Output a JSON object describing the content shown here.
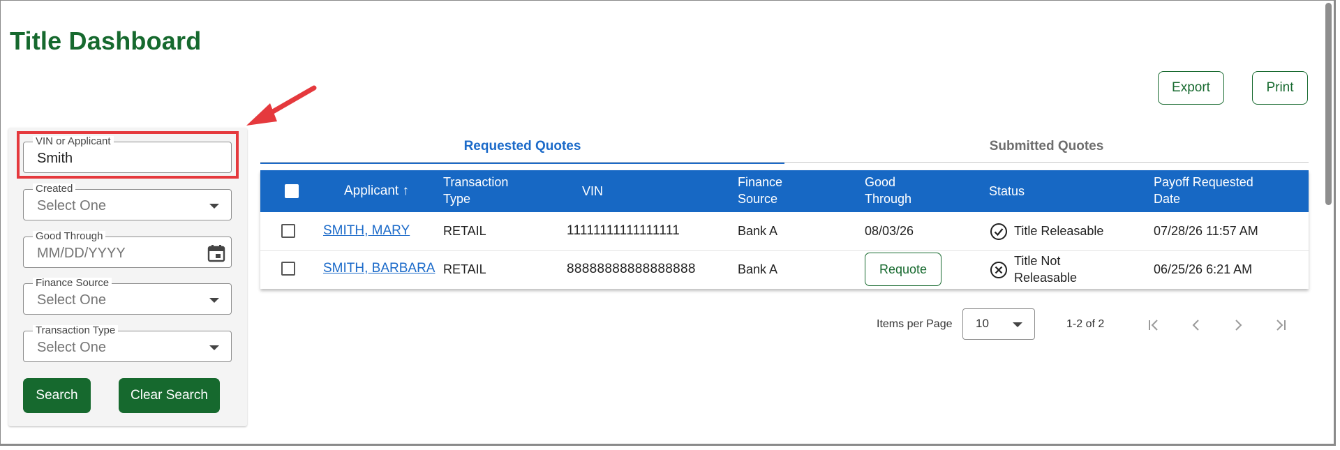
{
  "page": {
    "title": "Title Dashboard"
  },
  "actions": {
    "export_label": "Export",
    "print_label": "Print"
  },
  "filters": {
    "vin_or_applicant": {
      "label": "VIN or Applicant",
      "value": "Smith"
    },
    "created": {
      "label": "Created",
      "placeholder": "Select One"
    },
    "good_through": {
      "label": "Good Through",
      "placeholder": "MM/DD/YYYY"
    },
    "finance_source": {
      "label": "Finance Source",
      "placeholder": "Select One"
    },
    "transaction_type": {
      "label": "Transaction Type",
      "placeholder": "Select One"
    },
    "search_label": "Search",
    "clear_label": "Clear Search"
  },
  "tabs": [
    {
      "label": "Requested Quotes",
      "active": true
    },
    {
      "label": "Submitted Quotes",
      "active": false
    }
  ],
  "table": {
    "headers": {
      "applicant": "Applicant",
      "sort_indicator": "↑",
      "transaction_type_line1": "Transaction",
      "transaction_type_line2": "Type",
      "vin": "VIN",
      "finance_source_line1": "Finance",
      "finance_source_line2": "Source",
      "good_through_line1": "Good",
      "good_through_line2": "Through",
      "status": "Status",
      "payoff_line1": "Payoff Requested",
      "payoff_line2": "Date"
    },
    "rows": [
      {
        "applicant": "SMITH, MARY",
        "transaction_type": "RETAIL",
        "vin": "11111111111111111",
        "finance_source": "Bank A",
        "good_through": "08/03/26",
        "status_line1": "Title Releasable",
        "status_line2": "",
        "status_icon": "check-circle-icon",
        "payoff_date": "07/28/26 11:57 AM"
      },
      {
        "applicant": "SMITH, BARBARA",
        "transaction_type": "RETAIL",
        "vin": "88888888888888888",
        "finance_source": "Bank A",
        "good_through_action": "Requote",
        "status_line1": "Title Not",
        "status_line2": "Releasable",
        "status_icon": "x-circle-icon",
        "payoff_date": "06/25/26 6:21 AM"
      }
    ]
  },
  "pagination": {
    "items_per_page_label": "Items per Page",
    "items_per_page_value": "10",
    "range_text": "1-2 of 2"
  },
  "colors": {
    "brand_green": "#16692e",
    "header_blue": "#1768c4",
    "link_blue": "#1b6ac9",
    "highlight_red": "#e5393d"
  }
}
